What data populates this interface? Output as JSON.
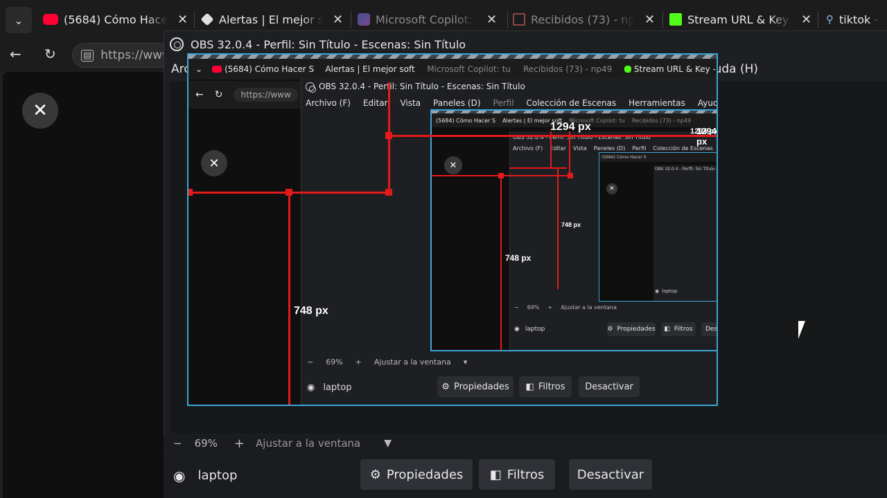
{
  "browser": {
    "tabs": [
      {
        "title": "(5684) Cómo Hacer S",
        "icon": "youtube-icon",
        "color": "#ff0033"
      },
      {
        "title": "Alertas | El mejor soft",
        "icon": "streamelements-icon",
        "color": "#e0e0e0"
      },
      {
        "title": "Microsoft Copilot: tu",
        "icon": "copilot-icon",
        "color": "#7b7bd6"
      },
      {
        "title": "Recibidos (73) - np49",
        "icon": "gmail-icon",
        "color": "#d44638"
      },
      {
        "title": "Stream URL & Key - K",
        "icon": "kick-icon",
        "color": "#53fc18"
      },
      {
        "title": "tiktok -",
        "icon": "search-icon",
        "color": "#8ab4f8"
      }
    ],
    "url": "https://www",
    "close_glyph": "✕"
  },
  "obs": {
    "title": "OBS 32.0.4 - Perfil: Sin Título - Escenas: Sin Título",
    "menu": [
      "Archivo (F)",
      "Editar",
      "Vista",
      "Paneles (D)",
      "Perfil",
      "Colección de Escenas",
      "Herramientas",
      "Ayuda (H)"
    ],
    "zoom": "69%",
    "fit_label": "Ajustar a la ventana",
    "source_name": "laptop",
    "properties_label": "Propiedades",
    "filters_label": "Filtros",
    "deactivate_label": "Desactivar",
    "minus": "−",
    "plus": "+"
  },
  "overlay": {
    "width_label": "1294 px",
    "height_label": "748 px",
    "accent_red": "#e31a1a",
    "accent_blue": "#3ba7d6"
  }
}
